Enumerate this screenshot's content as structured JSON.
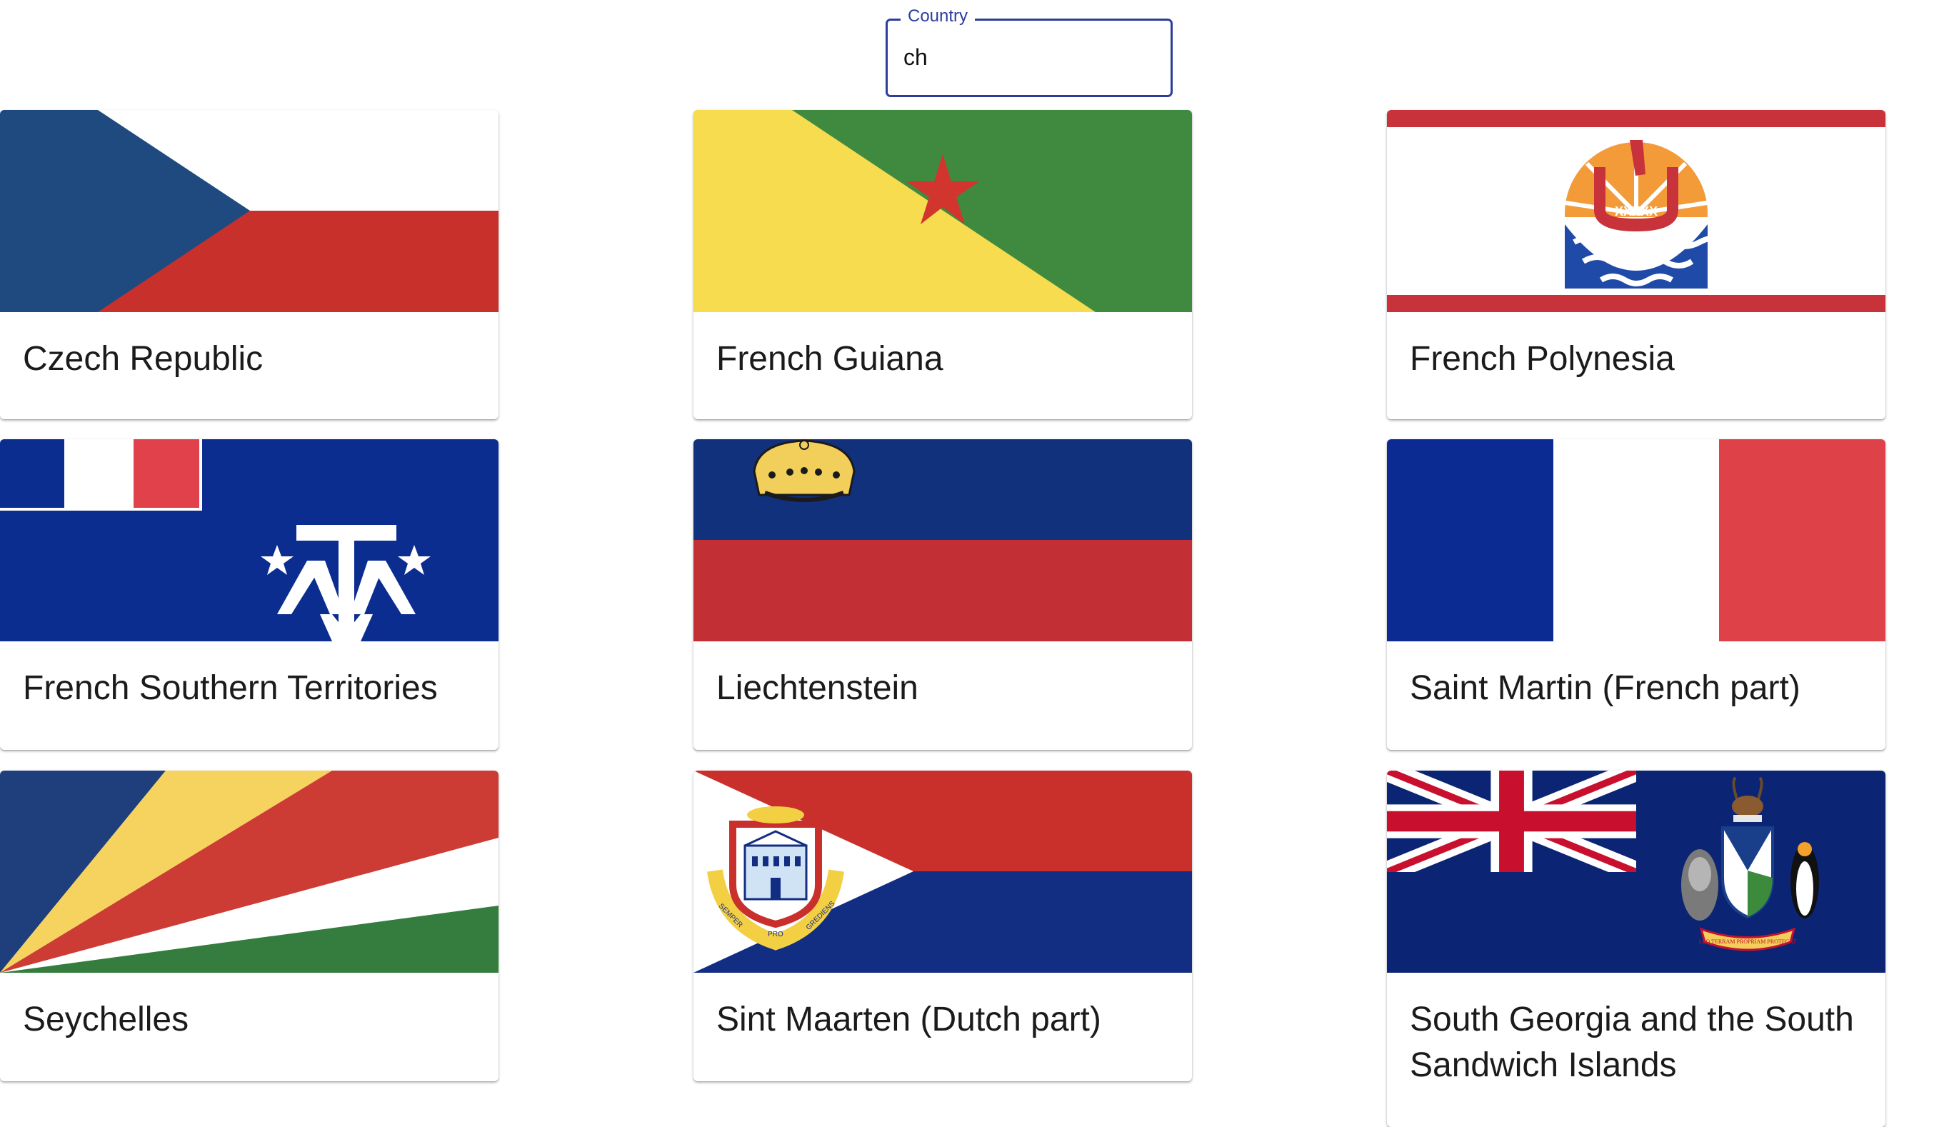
{
  "search": {
    "label": "Country",
    "value": "ch"
  },
  "flag_emblem_text": {
    "french_polynesia": "XXXXX",
    "sint_maarten_motto": [
      "SEMPER",
      "PRO",
      "GREDIENS"
    ],
    "south_georgia_motto": "LEO TERRAM PROPRIAM PROTEGAT"
  },
  "countries": [
    {
      "name": "Czech Republic",
      "flag_icon": "flag-czech-republic-icon"
    },
    {
      "name": "French Guiana",
      "flag_icon": "flag-french-guiana-icon"
    },
    {
      "name": "French Polynesia",
      "flag_icon": "flag-french-polynesia-icon"
    },
    {
      "name": "French Southern Territories",
      "flag_icon": "flag-french-southern-territories-icon"
    },
    {
      "name": "Liechtenstein",
      "flag_icon": "flag-liechtenstein-icon"
    },
    {
      "name": "Saint Martin (French part)",
      "flag_icon": "flag-saint-martin-icon"
    },
    {
      "name": "Seychelles",
      "flag_icon": "flag-seychelles-icon"
    },
    {
      "name": "Sint Maarten (Dutch part)",
      "flag_icon": "flag-sint-maarten-icon"
    },
    {
      "name": "South Georgia and the South Sandwich Islands",
      "flag_icon": "flag-south-georgia-icon"
    }
  ],
  "colors": {
    "accent": "#2c3e9c",
    "czech_blue": "#1f4a7f",
    "czech_red": "#c7302b",
    "guiana_yellow": "#f6dc4e",
    "guiana_green": "#3f8a3f",
    "guiana_star": "#d2342e",
    "polynesia_red": "#c8323a",
    "polynesia_orange": "#f29b38",
    "polynesia_blue": "#1f4aa8",
    "tf_blue": "#0a2d8f",
    "tf_red": "#e0414a",
    "li_blue": "#12317c",
    "li_red": "#c22f35",
    "li_gold": "#f2cf5a",
    "fr_blue": "#0c2b92",
    "fr_red": "#de4148",
    "sc_blue": "#1e3f7c",
    "sc_yellow": "#f5d35e",
    "sc_red": "#cc3b34",
    "sc_green": "#347d3e",
    "sx_red": "#c9302c",
    "sx_blue": "#122e83",
    "gs_blue": "#0b2574",
    "gs_red": "#c8102e"
  }
}
